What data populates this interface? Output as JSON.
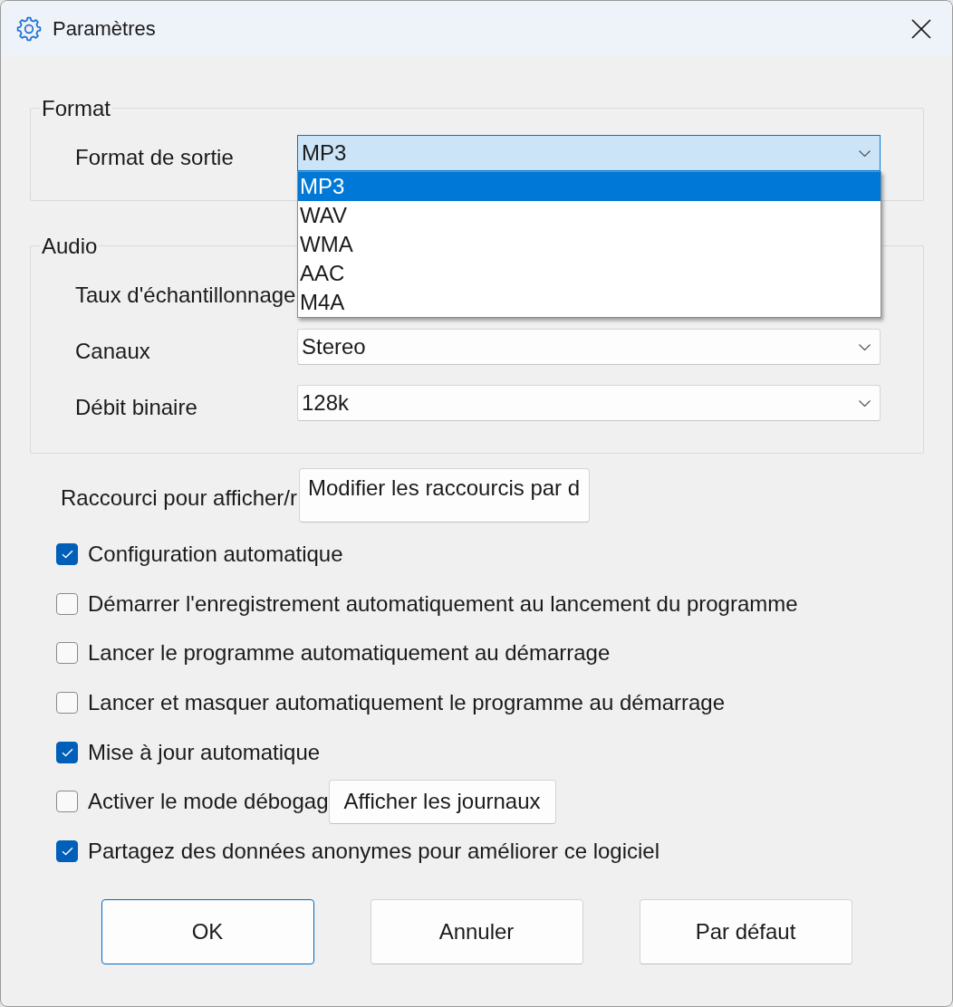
{
  "window": {
    "title": "Paramètres"
  },
  "format_group": {
    "legend": "Format",
    "output_format": {
      "label": "Format de sortie",
      "value": "MP3",
      "expanded": true,
      "options": [
        {
          "label": "MP3",
          "selected": true
        },
        {
          "label": "WAV",
          "selected": false
        },
        {
          "label": "WMA",
          "selected": false
        },
        {
          "label": "AAC",
          "selected": false
        },
        {
          "label": "M4A",
          "selected": false
        }
      ]
    }
  },
  "audio_group": {
    "legend": "Audio",
    "fields": [
      {
        "label": "Taux d'échantillonnage"
      },
      {
        "label": "Canaux",
        "value": "Stereo"
      },
      {
        "label": "Débit binaire",
        "value": "128k"
      }
    ]
  },
  "shortcut": {
    "label": "Raccourci pour afficher/r",
    "button": "Modifier les raccourcis par d"
  },
  "options": [
    {
      "label": "Configuration automatique",
      "checked": true
    },
    {
      "label": "Démarrer l'enregistrement automatiquement au lancement du programme",
      "checked": false
    },
    {
      "label": "Lancer le programme automatiquement au démarrage",
      "checked": false
    },
    {
      "label": "Lancer et masquer automatiquement le programme au démarrage",
      "checked": false
    },
    {
      "label": "Mise à jour automatique",
      "checked": true
    },
    {
      "label": "Activer le mode débogag",
      "checked": false,
      "button": "Afficher les journaux"
    },
    {
      "label": "Partagez des données anonymes pour améliorer ce logiciel",
      "checked": true
    }
  ],
  "buttons": [
    {
      "label": "OK",
      "default": true
    },
    {
      "label": "Annuler",
      "default": false
    },
    {
      "label": "Par défaut",
      "default": false
    }
  ]
}
